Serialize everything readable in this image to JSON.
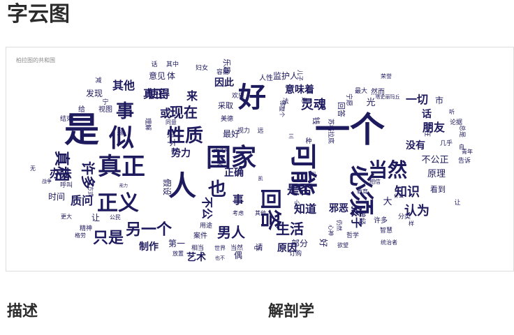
{
  "page": {
    "title": "字云图"
  },
  "wordcloud": {
    "caption": "柏拉图的共和国",
    "word_color": "#1e1a5e",
    "words": [
      {
        "t": "好"
      },
      {
        "t": "是"
      },
      {
        "t": "一个"
      },
      {
        "t": "国家"
      },
      {
        "t": "人"
      },
      {
        "t": "似"
      },
      {
        "t": "真正"
      },
      {
        "t": "可能"
      },
      {
        "t": "必须"
      },
      {
        "t": "回答"
      },
      {
        "t": "正义"
      },
      {
        "t": "事"
      },
      {
        "t": "性质"
      },
      {
        "t": "也"
      },
      {
        "t": "当然"
      },
      {
        "t": "另一个"
      },
      {
        "t": "只是"
      },
      {
        "t": "真相"
      },
      {
        "t": "许多"
      },
      {
        "t": "男人"
      },
      {
        "t": "生活"
      },
      {
        "t": "现在"
      },
      {
        "t": "灵魂"
      },
      {
        "t": "知识"
      },
      {
        "t": "认为"
      },
      {
        "t": "是否"
      },
      {
        "t": "知道"
      },
      {
        "t": "办法"
      },
      {
        "t": "质问"
      },
      {
        "t": "意味着"
      },
      {
        "t": "真正"
      },
      {
        "t": "使得"
      },
      {
        "t": "其他"
      },
      {
        "t": "或"
      },
      {
        "t": "来"
      },
      {
        "t": "因此"
      },
      {
        "t": "乐趣"
      },
      {
        "t": "监护人"
      },
      {
        "t": "光"
      },
      {
        "t": "一切"
      },
      {
        "t": "市"
      },
      {
        "t": "朋友"
      },
      {
        "t": "话"
      },
      {
        "t": "没有"
      },
      {
        "t": "不公正"
      },
      {
        "t": "原理"
      },
      {
        "t": "看到"
      },
      {
        "t": "孩子"
      },
      {
        "t": "邪恶"
      },
      {
        "t": "大"
      },
      {
        "t": "不公"
      },
      {
        "t": "制作"
      },
      {
        "t": "事"
      },
      {
        "t": "正确"
      },
      {
        "t": "让"
      },
      {
        "t": "时间"
      },
      {
        "t": "最好"
      },
      {
        "t": "假设"
      },
      {
        "t": "势力"
      },
      {
        "t": "决不"
      },
      {
        "t": "第一"
      },
      {
        "t": "艺术"
      },
      {
        "t": "偶"
      },
      {
        "t": "部分"
      },
      {
        "t": "原因"
      },
      {
        "t": "好"
      },
      {
        "t": "请"
      },
      {
        "t": "订购"
      },
      {
        "t": "发现"
      },
      {
        "t": "意见"
      },
      {
        "t": "体"
      },
      {
        "t": "话"
      },
      {
        "t": "其中"
      },
      {
        "t": "妇女"
      },
      {
        "t": "容易"
      },
      {
        "t": "减"
      },
      {
        "t": "给"
      },
      {
        "t": "视图"
      },
      {
        "t": "或"
      },
      {
        "t": "理解"
      },
      {
        "t": "采取"
      },
      {
        "t": "美德"
      },
      {
        "t": "欢乐"
      },
      {
        "t": "视力"
      },
      {
        "t": "远"
      },
      {
        "t": "人性"
      },
      {
        "t": "整个"
      },
      {
        "t": "儿子"
      },
      {
        "t": "走"
      },
      {
        "t": "钱"
      },
      {
        "t": "苏格拉底"
      },
      {
        "t": "回答"
      },
      {
        "t": "宁愿"
      },
      {
        "t": "最大"
      },
      {
        "t": "然而"
      },
      {
        "t": "荣誉"
      },
      {
        "t": "塔史丽玛丘"
      },
      {
        "t": "听"
      },
      {
        "t": "论据"
      },
      {
        "t": "总是"
      },
      {
        "t": "告诉"
      },
      {
        "t": "青年"
      },
      {
        "t": "相信"
      },
      {
        "t": "教育"
      },
      {
        "t": "分类"
      },
      {
        "t": "样"
      },
      {
        "t": "统治者"
      },
      {
        "t": "智慧"
      },
      {
        "t": "许多"
      },
      {
        "t": "哲学"
      },
      {
        "t": "欲望"
      },
      {
        "t": "心神"
      },
      {
        "t": "仍然"
      },
      {
        "t": "曾经"
      },
      {
        "t": "什么"
      },
      {
        "t": "小"
      },
      {
        "t": "问"
      },
      {
        "t": "其他"
      },
      {
        "t": "考虑"
      },
      {
        "t": "当然"
      },
      {
        "t": "世界"
      },
      {
        "t": "也不"
      },
      {
        "t": "案件"
      },
      {
        "t": "相当"
      },
      {
        "t": "放置"
      },
      {
        "t": "用途"
      },
      {
        "t": "精神"
      },
      {
        "t": "格劳"
      },
      {
        "t": "更大"
      },
      {
        "t": "公民"
      },
      {
        "t": "呼叫"
      },
      {
        "t": "方式"
      },
      {
        "t": "能力"
      },
      {
        "t": "战争"
      },
      {
        "t": "无"
      },
      {
        "t": "结束"
      },
      {
        "t": "宁"
      },
      {
        "t": "同意"
      },
      {
        "t": "关心"
      },
      {
        "t": "类"
      },
      {
        "t": "凯"
      },
      {
        "t": "法"
      },
      {
        "t": "三"
      },
      {
        "t": "现在"
      },
      {
        "t": "几乎"
      },
      {
        "t": "自"
      },
      {
        "t": "让"
      },
      {
        "t": "中"
      },
      {
        "t": "得"
      },
      {
        "t": "种"
      }
    ]
  },
  "sections": [
    {
      "title": "描述"
    },
    {
      "title": "解剖学"
    }
  ]
}
